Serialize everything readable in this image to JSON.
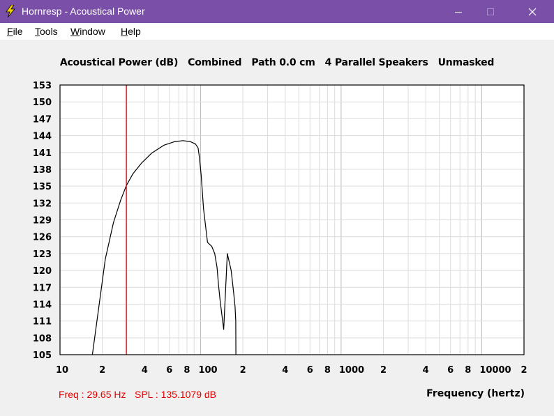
{
  "window": {
    "title": "Hornresp - Acoustical Power",
    "colors": {
      "titlebar": "#7a4fa8",
      "background": "#f0f0f0",
      "curve": "#000000",
      "marker": "#e00000",
      "grid": "#c8c8c8"
    }
  },
  "menu": {
    "items": [
      {
        "label": "File",
        "accel": "F",
        "rest": "ile"
      },
      {
        "label": "Tools",
        "accel": "T",
        "rest": "ools"
      },
      {
        "label": "Window",
        "accel": "W",
        "rest": "indow"
      },
      {
        "label": "Help",
        "accel": "H",
        "rest": "elp"
      }
    ]
  },
  "plot": {
    "header": "Acoustical Power (dB)   Combined   Path 0.0 cm   4 Parallel Speakers   Unmasked"
  },
  "readout": {
    "freq": "Freq : 29.65 Hz",
    "spl": "SPL : 135.1079 dB"
  },
  "chart_data": {
    "type": "line",
    "title": "Acoustical Power (dB)   Combined   Path 0.0 cm   4 Parallel Speakers   Unmasked",
    "xlabel": "Frequency (hertz)",
    "ylabel": "",
    "xscale": "log",
    "xlim": [
      10,
      20000
    ],
    "ylim": [
      105,
      153
    ],
    "yticks": [
      105,
      108,
      111,
      114,
      117,
      120,
      123,
      126,
      129,
      132,
      135,
      138,
      141,
      144,
      147,
      150,
      153
    ],
    "xtick_labels": [
      {
        "v": 10,
        "t": "10"
      },
      {
        "v": 20,
        "t": "2"
      },
      {
        "v": 40,
        "t": "4"
      },
      {
        "v": 60,
        "t": "6"
      },
      {
        "v": 80,
        "t": "8"
      },
      {
        "v": 100,
        "t": "100"
      },
      {
        "v": 200,
        "t": "2"
      },
      {
        "v": 400,
        "t": "4"
      },
      {
        "v": 600,
        "t": "6"
      },
      {
        "v": 800,
        "t": "8"
      },
      {
        "v": 1000,
        "t": "1000"
      },
      {
        "v": 2000,
        "t": "2"
      },
      {
        "v": 4000,
        "t": "4"
      },
      {
        "v": 6000,
        "t": "6"
      },
      {
        "v": 8000,
        "t": "8"
      },
      {
        "v": 10000,
        "t": "10000"
      },
      {
        "v": 20000,
        "t": "2"
      }
    ],
    "marker_x": 29.65,
    "grid": true,
    "series": [
      {
        "x": [
          17.0,
          19.0,
          21.0,
          24.0,
          27.0,
          29.65,
          33,
          38,
          45,
          55,
          65,
          75,
          85,
          92,
          96,
          98,
          101,
          105,
          112,
          120,
          126,
          131,
          134,
          138,
          142,
          146,
          155,
          165,
          172,
          176,
          178,
          178.5
        ],
        "y": [
          105,
          114,
          122,
          128.5,
          132.5,
          135.1,
          137.2,
          139.1,
          140.9,
          142.3,
          142.9,
          143.1,
          142.9,
          142.5,
          141.8,
          140.2,
          137,
          131,
          125,
          124.3,
          123,
          120.5,
          117.5,
          114.5,
          112,
          109.5,
          123,
          120,
          116,
          113.5,
          111,
          105
        ]
      }
    ]
  }
}
